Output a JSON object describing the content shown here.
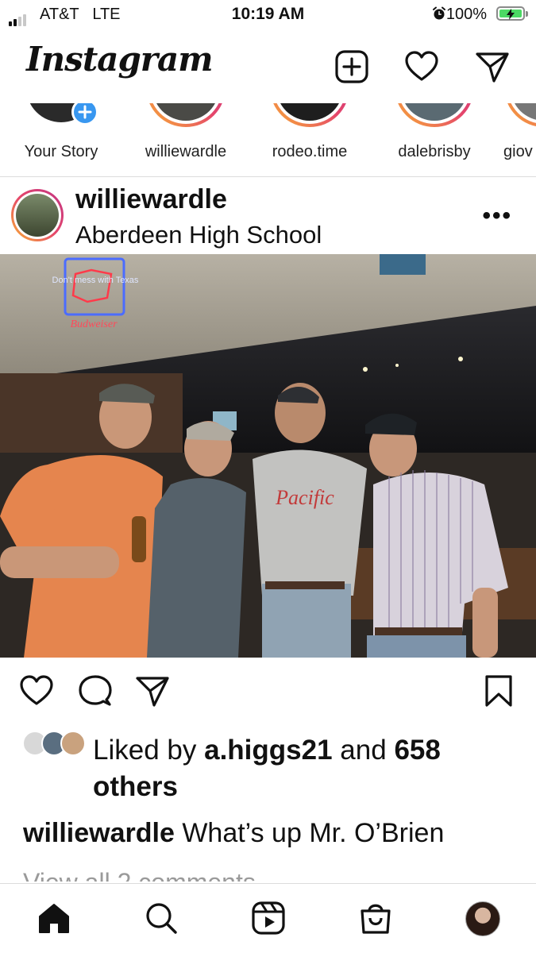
{
  "status_bar": {
    "carrier": "AT&T",
    "network": "LTE",
    "time": "10:19 AM",
    "battery": "100%"
  },
  "header": {
    "logo": "Instagram",
    "icons": [
      "new-post-icon",
      "heart-icon",
      "direct-message-icon"
    ]
  },
  "stories": [
    {
      "name": "Your Story"
    },
    {
      "name": "williewardle"
    },
    {
      "name": "rodeo.time"
    },
    {
      "name": "dalebrisby"
    },
    {
      "name": "giov"
    }
  ],
  "post": {
    "username": "williewardle",
    "location": "Aberdeen High School",
    "photo_sign_text": "Don't mess with Texas",
    "photo_sign_brand": "Budweiser",
    "shirt_text": "Pacific",
    "likes": {
      "prefix": "Liked by",
      "user": "a.higgs21",
      "middle": "and",
      "count": "658",
      "suffix": "others"
    },
    "caption_user": "williewardle",
    "caption_text": "What’s up Mr. O’Brien",
    "view_comments": "View all 2 comments"
  },
  "bottom_nav": [
    "home-icon",
    "search-icon",
    "reels-icon",
    "shop-icon",
    "profile-avatar"
  ],
  "colors": {
    "story_gradient": [
      "#f9b233",
      "#e5466b",
      "#c13584"
    ],
    "battery_green": "#4cd964",
    "add_story_blue": "#3897f0"
  }
}
